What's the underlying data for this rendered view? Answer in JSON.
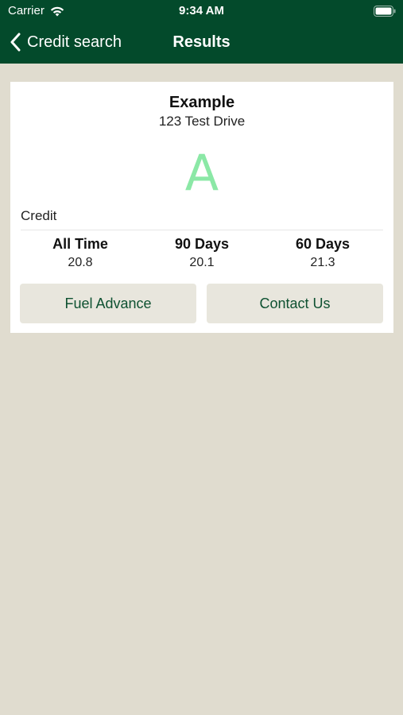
{
  "status_bar": {
    "carrier": "Carrier",
    "time": "9:34 AM"
  },
  "nav": {
    "back_label": "Credit search",
    "title": "Results"
  },
  "card": {
    "name": "Example",
    "address": "123 Test Drive",
    "grade": "A",
    "section_label": "Credit",
    "stats": [
      {
        "label": "All Time",
        "value": "20.8"
      },
      {
        "label": "90 Days",
        "value": "20.1"
      },
      {
        "label": "60 Days",
        "value": "21.3"
      }
    ],
    "buttons": {
      "fuel_advance": "Fuel Advance",
      "contact_us": "Contact Us"
    }
  },
  "colors": {
    "header": "#034a2b",
    "background": "#e0dccf",
    "grade": "#8be8a6",
    "button_text": "#0e5131"
  },
  "icons": [
    "wifi-icon",
    "battery-icon",
    "back-chevron-icon"
  ]
}
